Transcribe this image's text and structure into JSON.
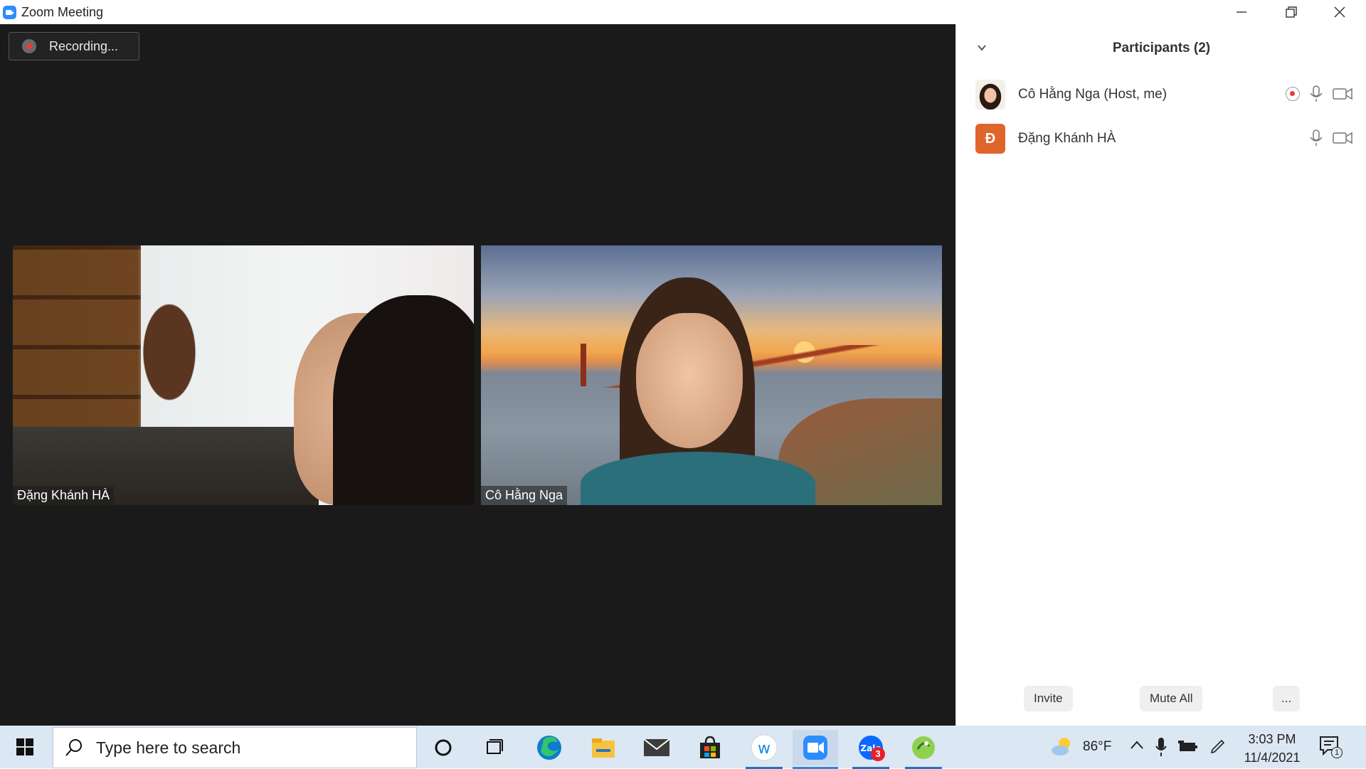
{
  "window": {
    "title": "Zoom Meeting",
    "controls": [
      "minimize-icon",
      "restore-icon",
      "close-icon"
    ]
  },
  "meeting": {
    "recording_label": "Recording...",
    "tiles": [
      {
        "name": "Đặng Khánh HÀ"
      },
      {
        "name": "Cô Hằng Nga"
      }
    ]
  },
  "participants": {
    "title": "Participants (2)",
    "list": [
      {
        "name": "Cô Hằng Nga (Host, me)",
        "avatar": "photo",
        "recording": true,
        "mic_icon": "microphone-icon",
        "video_icon": "video-camera-icon"
      },
      {
        "name": "Đặng Khánh HÀ",
        "avatar_initial": "Đ",
        "avatar_color": "#e0652b",
        "recording": false,
        "mic_icon": "microphone-icon",
        "video_icon": "video-camera-icon"
      }
    ],
    "buttons": {
      "invite": "Invite",
      "mute_all": "Mute All",
      "more": "..."
    }
  },
  "taskbar": {
    "search_placeholder": "Type here to search",
    "apps": [
      "cortana-icon",
      "task-view-icon",
      "edge-icon",
      "file-explorer-icon",
      "mail-icon",
      "store-icon",
      "w-app-icon",
      "zoom-icon",
      "zalo-icon",
      "green-app-icon"
    ],
    "zalo_badge": "3",
    "weather": "86°F",
    "time": "3:03 PM",
    "date": "11/4/2021",
    "notification_count": "1"
  },
  "colors": {
    "accent": "#2d8cff",
    "video_bg": "#1a1a1a",
    "taskbar": "#dbe7f3",
    "record_red": "#e63b3b"
  }
}
